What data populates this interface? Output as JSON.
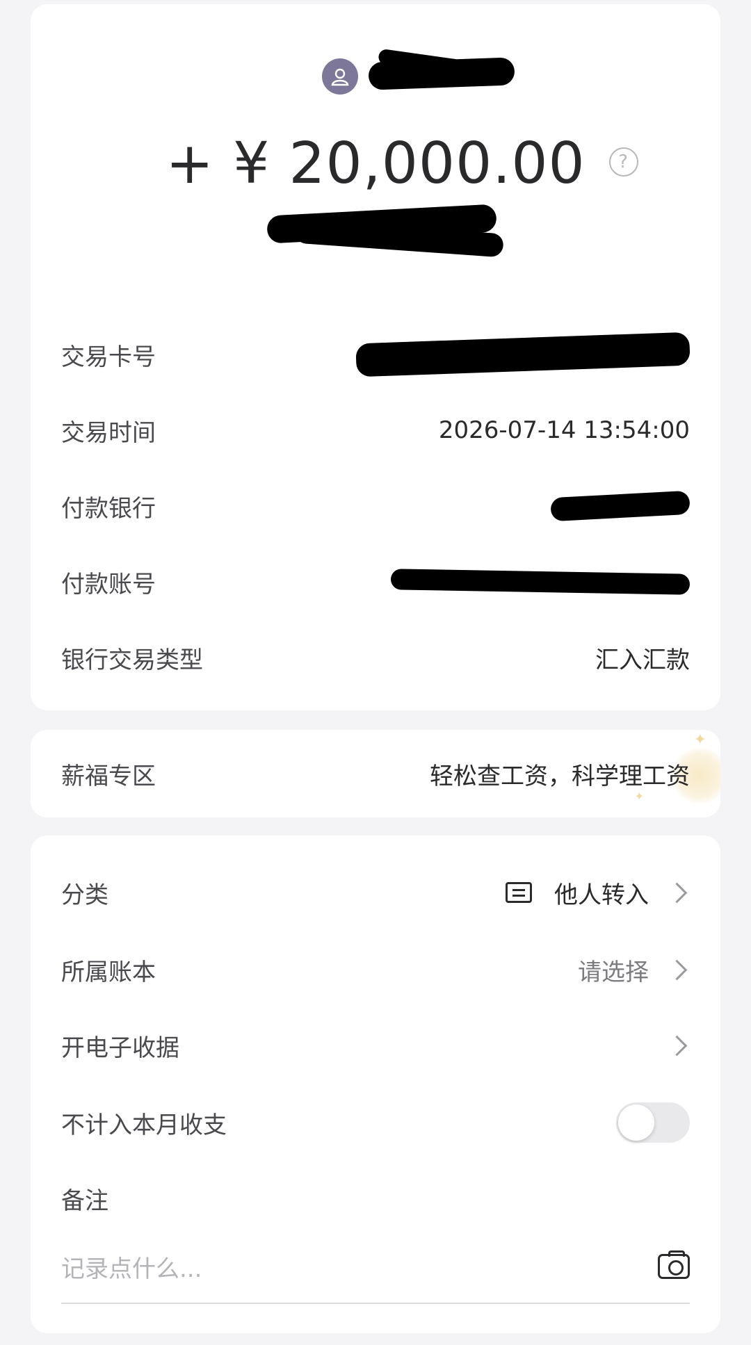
{
  "header": {
    "amount": "+ ¥ 20,000.00"
  },
  "details": [
    {
      "label": "交易卡号",
      "value": ""
    },
    {
      "label": "交易时间",
      "value": "2026-07-14 13:54:00"
    },
    {
      "label": "付款银行",
      "value": ""
    },
    {
      "label": "付款账号",
      "value": ""
    },
    {
      "label": "银行交易类型",
      "value": "汇入汇款"
    }
  ],
  "salary_zone": {
    "label": "薪福专区",
    "value": "轻松查工资，科学理工资"
  },
  "settings": {
    "category_label": "分类",
    "category_value": "他人转入",
    "book_label": "所属账本",
    "book_value": "请选择",
    "receipt_label": "开电子收据",
    "exclude_label": "不计入本月收支",
    "exclude_enabled": false,
    "note_label": "备注",
    "note_placeholder": "记录点什么..."
  }
}
